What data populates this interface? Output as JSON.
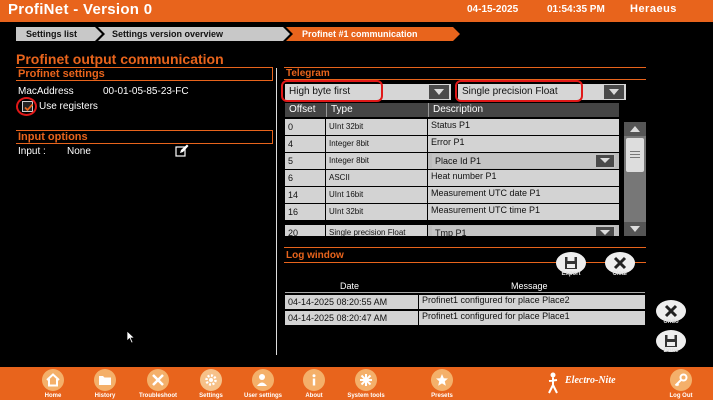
{
  "header": {
    "title": "ProfiNet  - Version 0",
    "date": "04-15-2025",
    "time": "01:54:35 PM",
    "brand": "Heraeus"
  },
  "breadcrumb": [
    "Settings list",
    "Settings version overview",
    "Profinet #1 communication"
  ],
  "page_title": "Profinet output communication",
  "profinet_settings": {
    "heading": "Profinet settings",
    "mac_label": "MacAddress",
    "mac_value": "00-01-05-85-23-FC",
    "use_registers_label": "Use registers",
    "use_registers_checked": true
  },
  "input_options": {
    "heading": "Input options",
    "input_label": "Input :",
    "input_value": "None"
  },
  "telegram": {
    "heading": "Telegram",
    "byte_order": "High byte first",
    "precision": "Single precision Float",
    "columns": [
      "Offset",
      "Type",
      "Description"
    ],
    "rows": [
      {
        "offset": "0",
        "type": "UInt 32bit",
        "description": "Status P1"
      },
      {
        "offset": "4",
        "type": "Integer 8bit",
        "description": "Error P1"
      },
      {
        "offset": "5",
        "type": "Integer 8bit",
        "description": "Place Id P1"
      },
      {
        "offset": "6",
        "type": "ASCII",
        "description": "Heat number P1"
      },
      {
        "offset": "14",
        "type": "UInt 16bit",
        "description": "Measurement UTC date P1"
      },
      {
        "offset": "16",
        "type": "UInt 32bit",
        "description": "Measurement UTC time P1"
      },
      {
        "offset": "20",
        "type": "Single precision Float",
        "description": "Tmp P1"
      }
    ]
  },
  "log_window": {
    "heading": "Log window",
    "export_label": "Export",
    "clear_label": "Clear",
    "undo_label": "Undo",
    "done_label": "Done",
    "columns": [
      "Date",
      "Message"
    ],
    "rows": [
      {
        "date": "04-14-2025 08:20:55 AM",
        "message": "Profinet1 configured for place Place2"
      },
      {
        "date": "04-14-2025 08:20:47 AM",
        "message": "Profinet1 configured for place Place1"
      }
    ]
  },
  "footer": {
    "buttons": [
      "Home",
      "History",
      "Troubleshoot",
      "Settings",
      "User settings",
      "About",
      "System tools",
      "Presets"
    ],
    "logo": "Electro-Nite",
    "logout": "Log Out"
  },
  "colors": {
    "accent": "#e8641c",
    "highlight": "#e01818",
    "row": "#d3d3d3"
  }
}
